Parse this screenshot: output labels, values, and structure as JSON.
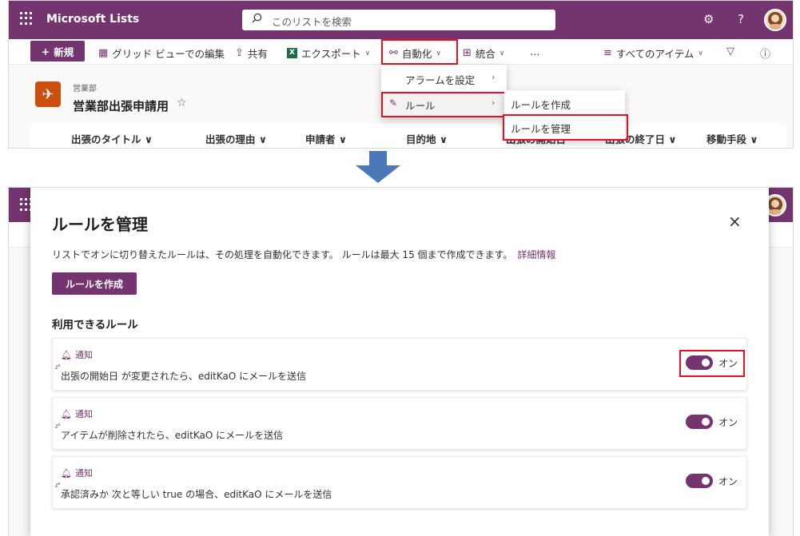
{
  "top": {
    "app_title": "Microsoft Lists",
    "search_placeholder": "このリストを検索",
    "toolbar": {
      "new_label": "新規",
      "grid_edit_label": "グリッド ビューでの編集",
      "share_label": "共有",
      "export_label": "エクスポート",
      "automate_label": "自動化",
      "integrate_label": "統合",
      "more_label": "…",
      "view_label": "すべてのアイテム"
    },
    "list": {
      "breadcrumb": "営業部",
      "title": "営業部出張申請用"
    },
    "columns": [
      "出張のタイトル",
      "出張の理由",
      "申請者",
      "目的地",
      "出張の開始日",
      "出張の終了日",
      "移動手段"
    ],
    "automate_menu": {
      "items": [
        "アラームを設定",
        "ルール"
      ]
    },
    "rules_submenu": {
      "items": [
        "ルールを作成",
        "ルールを管理"
      ]
    }
  },
  "panel": {
    "title": "ルールを管理",
    "description": "リストでオンに切り替えたルールは、その処理を自動化できます。 ルールは最大 15 個まで作成できます。",
    "learn_more": "詳細情報",
    "create_button": "ルールを作成",
    "section_title": "利用できるルール",
    "rules": [
      {
        "type": "通知",
        "text": "出張の開始日 が変更されたら、editKaO にメールを送信",
        "status": "オン",
        "enabled": true
      },
      {
        "type": "通知",
        "text": "アイテムが削除されたら、editKaO にメールを送信",
        "status": "オン",
        "enabled": true
      },
      {
        "type": "通知",
        "text": "承認済みか 次と等しい true の場合、editKaO にメールを送信",
        "status": "オン",
        "enabled": true
      }
    ]
  },
  "colors": {
    "brand": "#74346f",
    "highlight": "#e81123",
    "arrow": "#4a78b8",
    "list_icon": "#ca5010"
  }
}
